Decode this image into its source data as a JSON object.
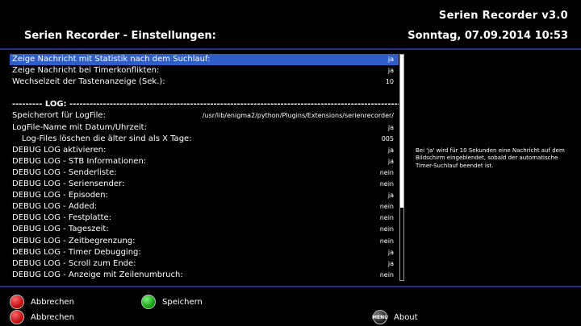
{
  "header": {
    "app_title": "Serien Recorder v3.0",
    "page_title": "Serien Recorder - Einstellungen:",
    "datetime": "Sonntag, 07.09.2014  10:53"
  },
  "settings": [
    {
      "label": "Zeige Nachricht mit Statistik nach dem Suchlauf:",
      "value": "ja"
    },
    {
      "label": "Zeige Nachricht bei Timerkonflikten:",
      "value": "ja"
    },
    {
      "label": "Wechselzeit der Tastenanzeige (Sek.):",
      "value": "10"
    },
    {
      "label": "",
      "value": ""
    },
    {
      "label": "---------  LOG:  -----------------------------------------------------------------------------------------------------",
      "value": ""
    },
    {
      "label": "Speicherort für LogFile:",
      "value": "/usr/lib/enigma2/python/Plugins/Extensions/serienrecorder/"
    },
    {
      "label": "LogFile-Name mit Datum/Uhrzeit:",
      "value": "ja"
    },
    {
      "label": "Log-Files löschen die älter sind als X Tage:",
      "value": "005"
    },
    {
      "label": "DEBUG LOG aktivieren:",
      "value": "ja"
    },
    {
      "label": "DEBUG LOG - STB Informationen:",
      "value": "ja"
    },
    {
      "label": "DEBUG LOG - Senderliste:",
      "value": "nein"
    },
    {
      "label": "DEBUG LOG - Seriensender:",
      "value": "nein"
    },
    {
      "label": "DEBUG LOG - Episoden:",
      "value": "ja"
    },
    {
      "label": "DEBUG LOG - Added:",
      "value": "nein"
    },
    {
      "label": "DEBUG LOG - Festplatte:",
      "value": "nein"
    },
    {
      "label": "DEBUG LOG - Tageszeit:",
      "value": "nein"
    },
    {
      "label": "DEBUG LOG - Zeitbegrenzung:",
      "value": "nein"
    },
    {
      "label": "DEBUG LOG - Timer Debugging:",
      "value": "ja"
    },
    {
      "label": "DEBUG LOG - Scroll zum Ende:",
      "value": "ja"
    },
    {
      "label": "DEBUG LOG - Anzeige mit Zeilenumbruch:",
      "value": "nein"
    }
  ],
  "help_text": "Bei 'ja' wird für 10 Sekunden eine Nachricht auf dem Bildschirm eingeblendet, sobald der automatische Timer-Suchlauf beendet ist.",
  "buttons": {
    "red_top": "Abbrechen",
    "green": "Speichern",
    "red_bottom": "Abbrechen",
    "about": "About",
    "menu_icon_text": "MENU"
  }
}
